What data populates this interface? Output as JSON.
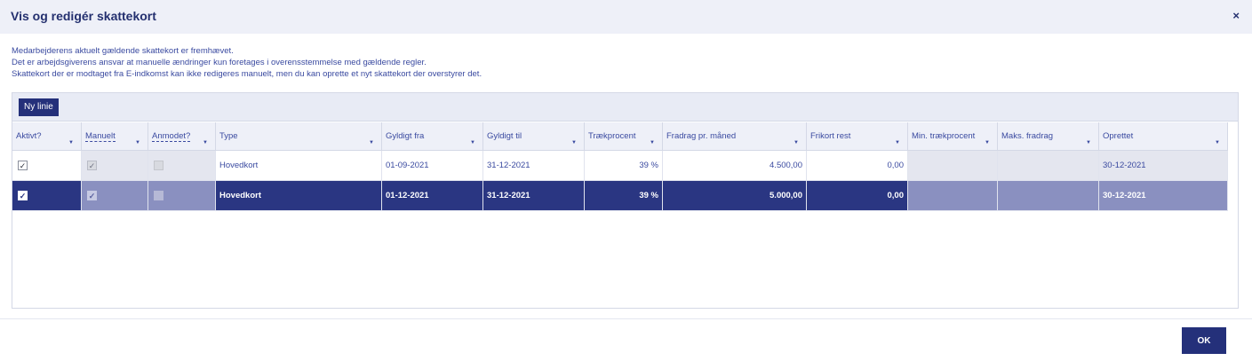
{
  "dialog": {
    "title": "Vis og redigér skattekort",
    "close_icon": "×",
    "info_lines": [
      "Medarbejderens aktuelt gældende skattekort er fremhævet.",
      "Det er arbejdsgiverens ansvar at manuelle ændringer kun foretages i overensstemmelse med gældende regler.",
      "Skattekort der er modtaget fra E-indkomst kan ikke redigeres manuelt, men du kan oprette et nyt skattekort der overstyrer det."
    ],
    "new_line_label": "Ny linie",
    "ok_label": "OK"
  },
  "table": {
    "columns": [
      "Aktivt?",
      "Manuelt",
      "Anmodet?",
      "Type",
      "Gyldigt fra",
      "Gyldigt til",
      "Trækprocent",
      "Fradrag pr. måned",
      "Frikort rest",
      "Min. trækprocent",
      "Maks. fradrag",
      "Oprettet"
    ],
    "rows": [
      {
        "aktivt": true,
        "manuelt": true,
        "anmodet": false,
        "type": "Hovedkort",
        "gyldigt_fra": "01-09-2021",
        "gyldigt_til": "31-12-2021",
        "traekprocent": "39 %",
        "fradrag": "4.500,00",
        "frikort_rest": "0,00",
        "min_traekprocent": "",
        "maks_fradrag": "",
        "oprettet": "30-12-2021",
        "selected": false
      },
      {
        "aktivt": true,
        "manuelt": true,
        "anmodet": false,
        "type": "Hovedkort",
        "gyldigt_fra": "01-12-2021",
        "gyldigt_til": "31-12-2021",
        "traekprocent": "39 %",
        "fradrag": "5.000,00",
        "frikort_rest": "0,00",
        "min_traekprocent": "",
        "maks_fradrag": "",
        "oprettet": "30-12-2021",
        "selected": true
      }
    ]
  },
  "colors": {
    "accent": "#24307a",
    "selected_row": "#2a3682",
    "header_bg": "#eef0f8"
  }
}
